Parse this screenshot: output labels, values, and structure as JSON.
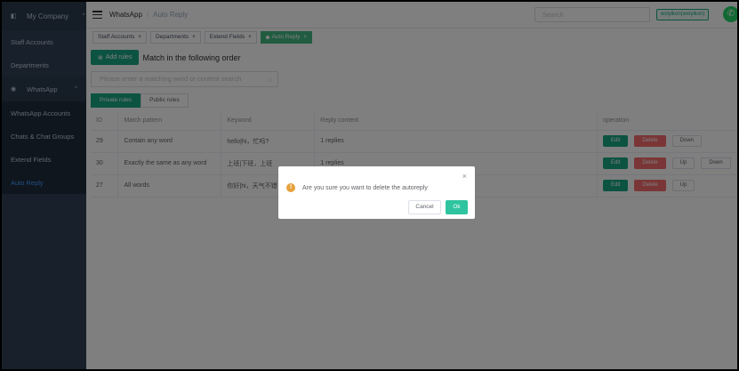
{
  "sidebar": {
    "brand": "My Company",
    "items_top": [
      "Staff Accounts",
      "Departments"
    ],
    "group_label": "WhatsApp",
    "sub_items": [
      "WhatsApp Accounts",
      "Chats & Chat Groups",
      "Extend Fields",
      "Auto Reply"
    ]
  },
  "header": {
    "breadcrumb_root": "WhatsApp",
    "breadcrumb_current": "Auto Reply",
    "search_placeholder": "Search",
    "user": "wxiylkon(wxiylkon)"
  },
  "tags": [
    "Staff Accounts",
    "Departments",
    "Extend Fields",
    "Auto Reply"
  ],
  "toolbar": {
    "add_label": "Add rules",
    "match_title": "Match in the following order",
    "keyword_placeholder": "Please enter a matching word or content search",
    "tabs": [
      "Private rules",
      "Public rules"
    ]
  },
  "table": {
    "headers": [
      "ID",
      "Match pattern",
      "Keyword",
      "Reply content",
      "operation"
    ],
    "rows": [
      {
        "id": "29",
        "pattern": "Contain any word",
        "keyword": "hello|hi，忙吗?",
        "reply": "1 replies",
        "ops": [
          "Edit",
          "Delete",
          "Down"
        ]
      },
      {
        "id": "30",
        "pattern": "Exactly the same as any word",
        "keyword": "上班|下班，上班",
        "reply": "1 replies",
        "ops": [
          "Edit",
          "Delete",
          "Up",
          "Down"
        ]
      },
      {
        "id": "27",
        "pattern": "All words",
        "keyword": "你好|hi，天气不错",
        "reply": "",
        "ops": [
          "Edit",
          "Delete",
          "Up"
        ]
      }
    ]
  },
  "dialog": {
    "message": "Are you sure you want to delete the autoreply",
    "cancel": "Cancel",
    "ok": "Ok"
  }
}
